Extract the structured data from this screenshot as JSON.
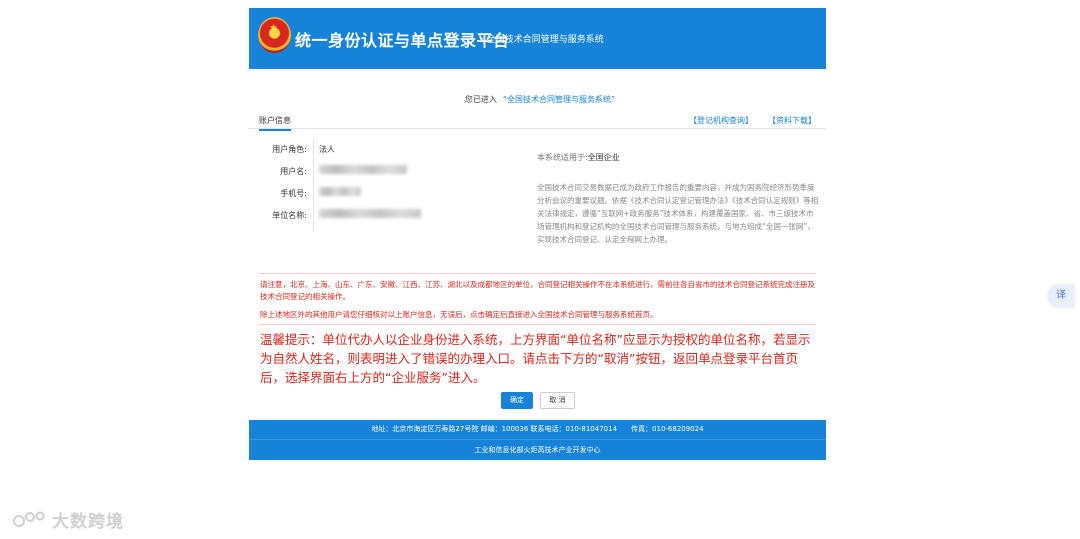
{
  "header": {
    "title": "统一身份认证与单点登录平台",
    "subtitle": "· 全国技术合同管理与服务系统"
  },
  "entered": {
    "prefix": "您已进入",
    "system": "“全国技术合同管理与服务系统”"
  },
  "tabs": {
    "account": "账户信息",
    "org_query": "【登记机构查询】",
    "download": "【资料下载】"
  },
  "account": {
    "role_label": "用户角色:",
    "role_value": "法人",
    "username_label": "用户名:",
    "phone_label": "手机号:",
    "unit_label": "单位名称:"
  },
  "applies": {
    "label": "本系统适用于:",
    "value": "全国企业"
  },
  "description": "全国技术合同交易数据已成为政府工作报告的重要内容，并成为国务院经济形势季度分析会议的重要议题。依据《技术合同认定登记管理办法》《技术合同认定规则》等相关法律规定，遵循“互联网+政务服务”技术体系，构建覆盖国家、省、市三级技术市场管理机构和登记机构的全国技术合同管理与服务系统，与地方组成“全国一张网”，实现技术合同登记、认定全程网上办理。",
  "notice": {
    "line1": "请注意，北京、上海、山东、广东、安徽、江西、江苏、湖北以及成都地区的单位，合同登记相关操作不在本系统进行，需前往各自省市的技术合同登记系统完成注册及技术合同登记的相关操作。",
    "line2": "除上述地区外的其他用户请您仔细核对以上账户信息，无误后，点击确定后直接进入全国技术合同管理与服务系统首页。"
  },
  "tips": "温馨提示：单位代办人以企业身份进入系统，上方界面“单位名称”应显示为授权的单位名称，若显示为自然人姓名，则表明进入了错误的办理入口。请点击下方的“取消”按钮，返回单点登录平台首页后，选择界面右上方的“企业服务”进入。",
  "buttons": {
    "ok": "确定",
    "cancel": "取 消"
  },
  "footer": {
    "address": "地址：北京市海淀区万寿路27号院 邮编：100036 联系电话：010-81047014　　传真：010-68209024",
    "org": "工业和信息化部火炬高技术产业开发中心"
  },
  "floating": {
    "translate": "译"
  },
  "watermark": {
    "text": "大数跨境"
  }
}
